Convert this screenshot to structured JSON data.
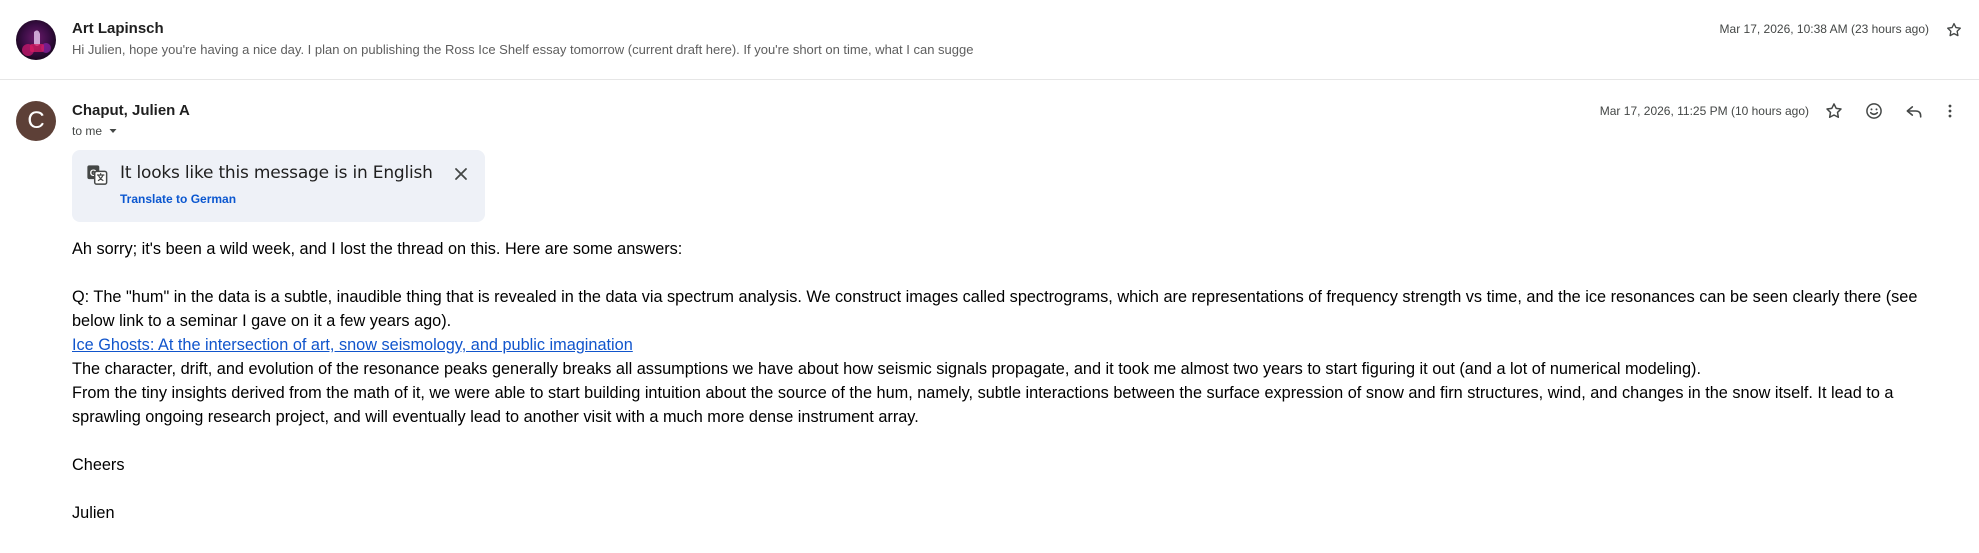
{
  "message1": {
    "sender": "Art Lapinsch",
    "snippet": "Hi Julien, hope you're having a nice day. I plan on publishing the Ross Ice Shelf essay tomorrow (current draft here). If you're short on time, what I can sugge",
    "date": "Mar 17, 2026, 10:38 AM (23 hours ago)",
    "star_icon": "star-outline-icon"
  },
  "message2": {
    "avatar_letter": "C",
    "avatar_color": "#5d4037",
    "sender": "Chaput, Julien A",
    "recipient": "to me",
    "date": "Mar 17, 2026, 11:25 PM (10 hours ago)",
    "actions": {
      "star": "star-outline-icon",
      "emoji": "emoji-reaction-icon",
      "reply": "reply-icon",
      "more": "more-vertical-icon"
    },
    "translate": {
      "text": "It looks like this message is in English",
      "link": "Translate to German"
    },
    "body": {
      "greeting": "Ah sorry; it's been a wild week, and I lost the thread on this. Here are some answers:",
      "q1": "Q: The \"hum\" in the data is a subtle, inaudible thing that is revealed in the data via spectrum analysis. We construct images called spectrograms, which are representations of frequency strength vs time, and the ice resonances can be seen clearly there (see below link to a seminar I gave on it a few years ago).",
      "link": "Ice Ghosts: At the intersection of art, snow seismology, and public imagination",
      "p2": "The character, drift, and evolution of the resonance peaks generally breaks all assumptions we have about how seismic signals propagate, and it took me almost two years to start figuring it out (and a lot of numerical modeling).",
      "p3": "From the tiny insights derived from the math of it, we were able to start building intuition about the source of the hum, namely, subtle interactions between the surface expression of snow and firn structures, wind, and changes in the snow itself. It lead to a sprawling ongoing research project, and will eventually lead to another visit with a much more dense instrument array.",
      "closing": "Cheers",
      "signature": "Julien"
    }
  },
  "colors": {
    "link": "#1155cc",
    "banner_bg": "#eef1f7",
    "banner_link": "#0b57d0"
  }
}
